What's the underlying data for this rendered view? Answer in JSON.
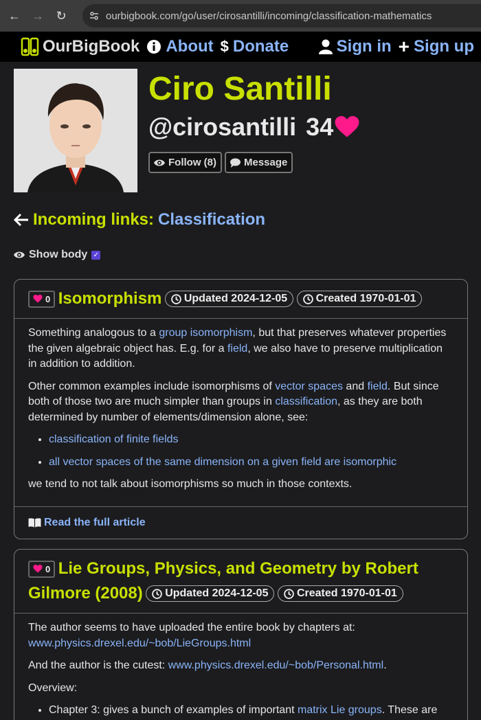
{
  "browser": {
    "url": "ourbigbook.com/go/user/cirosantilli/incoming/classification-mathematics"
  },
  "header": {
    "brand": "OurBigBook",
    "about": "About",
    "donate": "Donate",
    "signin": "Sign in",
    "signup": "Sign up"
  },
  "profile": {
    "name": "Ciro Santilli",
    "handle": "@cirosantilli",
    "score": "34",
    "follow_label": "Follow (8)",
    "message_label": "Message"
  },
  "incoming": {
    "label": "Incoming links:",
    "target": "Classification"
  },
  "show_body": "Show body",
  "articles": [
    {
      "likes": "0",
      "title": "Isomorphism",
      "updated": "Updated 2024-12-05",
      "created": "Created 1970-01-01",
      "p1": [
        "Something analogous to a ",
        "group isomorphism",
        ", but that preserves whatever properties the given algebraic object has. E.g. for a ",
        "field",
        ", we also have to preserve multiplication in addition to addition."
      ],
      "p2": [
        "Other common examples include isomorphisms of ",
        "vector spaces",
        " and ",
        "field",
        ". But since both of those two are much simpler than groups in ",
        "classification",
        ", as they are both determined by number of elements/dimension alone, see:"
      ],
      "bullets": [
        "classification of finite fields",
        "all vector spaces of the same dimension on a given field are isomorphic"
      ],
      "p3": "we tend to not talk about isomorphisms so much in those contexts.",
      "read_more": "Read the full article"
    },
    {
      "likes": "0",
      "title": "Lie Groups, Physics, and Geometry by Robert Gilmore (2008)",
      "updated": "Updated 2024-12-05",
      "created": "Created 1970-01-01",
      "p1": [
        "The author seems to have uploaded the entire book by chapters at: ",
        "www.physics.drexel.edu/~bob/LieGroups.html"
      ],
      "p2": [
        "And the author is the cutest: ",
        "www.physics.drexel.edu/~bob/Personal.html",
        "."
      ],
      "p3": "Overview:",
      "bullet": [
        "Chapter 3: gives a bunch of examples of important ",
        "matrix Lie groups",
        ". These are"
      ]
    }
  ],
  "colors": {
    "accent_title": "#c8e000",
    "link": "#8ab4f8",
    "heart": "#ff1a8c"
  }
}
